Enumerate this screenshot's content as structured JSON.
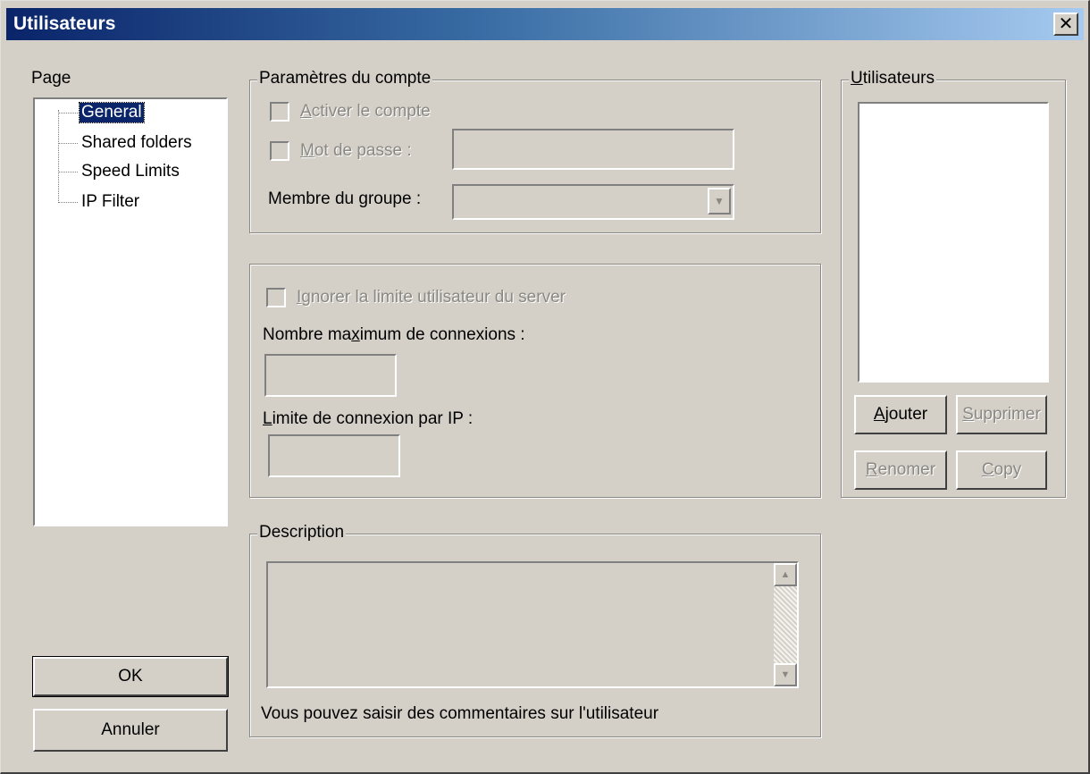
{
  "window": {
    "title": "Utilisateurs",
    "close_glyph": "✕"
  },
  "page_panel": {
    "label": "Page",
    "tree": [
      {
        "label": "General",
        "selected": true
      },
      {
        "label": "Shared folders"
      },
      {
        "label": "Speed Limits"
      },
      {
        "label": "IP Filter"
      }
    ]
  },
  "account_group": {
    "legend": "Paramètres du compte",
    "enable_account": {
      "label_mnemonic": "A",
      "label_rest": "ctiver le compte",
      "checked": false
    },
    "password": {
      "label_mnemonic": "M",
      "label_rest": "ot de passe :",
      "checked": false,
      "value": ""
    },
    "group_member": {
      "label": "Membre du groupe :",
      "value": ""
    }
  },
  "limits_group": {
    "ignore_limit": {
      "label_mnemonic": "I",
      "label_rest": "gnorer la limite utilisateur du server",
      "checked": false
    },
    "max_connections": {
      "label_pre": "Nombre ma",
      "label_mnemonic": "x",
      "label_post": "imum de connexions :",
      "value": ""
    },
    "ip_limit": {
      "label_mnemonic": "L",
      "label_rest": "imite de connexion par IP :",
      "value": ""
    }
  },
  "description_group": {
    "legend": "Description",
    "value": "",
    "hint": "Vous pouvez saisir des commentaires sur l'utilisateur"
  },
  "users_group": {
    "legend_mnemonic": "U",
    "legend_rest": "tilisateurs",
    "users": [],
    "add_button": {
      "mnemonic": "A",
      "rest": "jouter"
    },
    "delete_button": {
      "mnemonic": "S",
      "rest": "upprimer"
    },
    "rename_button": {
      "mnemonic": "R",
      "rest": "enomer"
    },
    "copy_button": {
      "mnemonic": "C",
      "rest": "opy"
    }
  },
  "footer": {
    "ok_label": "OK",
    "cancel_label": "Annuler"
  },
  "icons": {
    "dropdown_arrow": "▼",
    "scroll_up": "▲",
    "scroll_down": "▼"
  },
  "colors": {
    "titlebar_start": "#0a246a",
    "titlebar_end": "#a6caf0",
    "dialog_face": "#d4d0c8",
    "disabled_text": "#8a8883",
    "selection": "#0a246a"
  }
}
